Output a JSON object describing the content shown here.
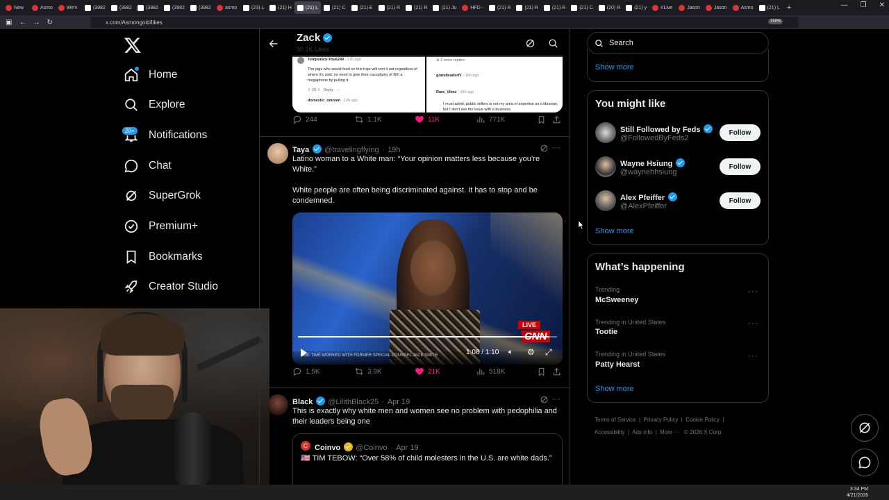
{
  "browser": {
    "tabs": [
      "New",
      "Asmo",
      "We'v",
      "(3982",
      "(3982",
      "(3982",
      "(3982",
      "(3982",
      "asmo",
      "(23) L",
      "(21) H",
      "(21) L",
      "(21) C",
      "(21) E",
      "(21) R",
      "(21) R",
      "(21) Ju",
      "HFD -",
      "(21) R",
      "(21) R",
      "(21) R",
      "(21) C",
      "(20) R",
      "(21) y",
      "r/Live",
      "Jason",
      "Jason",
      "Asmo",
      "(21) L"
    ],
    "active_tab_index": 11,
    "url": "x.com/Asmongold/likes",
    "zoom": "150%"
  },
  "nav": {
    "home": "Home",
    "explore": "Explore",
    "notifications": "Notifications",
    "notifications_badge": "20+",
    "chat": "Chat",
    "supergrok": "SuperGrok",
    "premium": "Premium+",
    "bookmarks": "Bookmarks",
    "creator_studio": "Creator Studio"
  },
  "header": {
    "name": "Zack",
    "subtitle": "30.1K Likes"
  },
  "embedded_comments": {
    "left": [
      {
        "user": "Temporary-You6249",
        "time": "17h ago",
        "text": "The pigs who would feed on this tripe will root it out regardless of where it's sold, no need to give their cacophony of filth a megaphone by pulling it.",
        "votes": "28",
        "reply": "Reply"
      },
      {
        "user": "domestic_omnom",
        "time": "12h ago"
      }
    ],
    "right": [
      {
        "text": "2 more replies"
      },
      {
        "user": "grandleaderIV",
        "time": "18h ago"
      },
      {
        "user": "Rare_Vibez",
        "time": "18h ago",
        "text": "I must admit, public sellers is not my area of expertise as a librarian, but I don't see the issue with a business"
      }
    ]
  },
  "tweet1_actions": {
    "replies": "244",
    "reposts": "1.1K",
    "likes": "11K",
    "views": "771K"
  },
  "tweet2": {
    "name": "Taya",
    "handle": "@travelingflying",
    "time": "19h",
    "text1": "Latino woman to a White man: “Your opinion matters less because you’re White.”",
    "text2": "White people are often being discriminated against. It has to stop and be condemned.",
    "video": {
      "time": "1:08 / 1:10",
      "live": "LIVE",
      "network": "CNN",
      "ticker": "ONE TIME WORKED WITH FORMER SPECIAL COUNSEL JACK SMITH"
    },
    "actions": {
      "replies": "1.5K",
      "reposts": "3.9K",
      "likes": "21K",
      "views": "518K"
    }
  },
  "tweet3": {
    "name": "Black",
    "handle": "@LilithBlack25",
    "time": "Apr 19",
    "text": "This is exactly why white men and women see no problem with pedophilia and their leaders being one",
    "quote": {
      "name": "Coinvo",
      "handle": "@Coinvo",
      "time": "Apr 19",
      "text": "🇺🇸 TIM TEBOW: “Over 58% of child molesters in the U.S. are white dads.”"
    }
  },
  "search": {
    "placeholder": "Search"
  },
  "show_more_top": "Show more",
  "you_might_like": {
    "title": "You might like",
    "users": [
      {
        "name": "Still Followed by Feds",
        "handle": "@FollowedByFeds2",
        "button": "Follow"
      },
      {
        "name": "Wayne Hsiung",
        "handle": "@waynehhsiung",
        "button": "Follow"
      },
      {
        "name": "Alex Pfeiffer",
        "handle": "@AlexPfeiffer",
        "button": "Follow"
      }
    ],
    "show_more": "Show more"
  },
  "whats_happening": {
    "title": "What’s happening",
    "trends": [
      {
        "meta": "Trending",
        "name": "McSweeney"
      },
      {
        "meta": "Trending in United States",
        "name": "Tootie"
      },
      {
        "meta": "Trending in United States",
        "name": "Patty Hearst"
      }
    ],
    "show_more": "Show more"
  },
  "footer": {
    "terms": "Terms of Service",
    "privacy": "Privacy Policy",
    "cookie": "Cookie Policy",
    "accessibility": "Accessibility",
    "ads": "Ads info",
    "more": "More ···",
    "copyright": "© 2026 X Corp."
  },
  "taskbar": {
    "time": "3:34 PM",
    "date": "4/21/2026"
  },
  "colors": {
    "accent": "#1d9bf0",
    "like": "#f91880",
    "background": "#000000"
  }
}
